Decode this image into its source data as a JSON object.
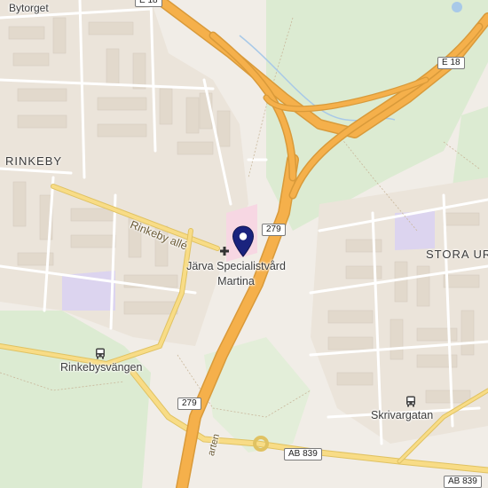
{
  "places": {
    "bytorget": "Bytorget",
    "rinkeby": "RINKEBY",
    "stora_ur": "STORA UR",
    "rinkebysvangen": "Rinkebysvängen",
    "skrivargatan": "Skrivargatan",
    "rinkeby_alle": "Rinkeby allé",
    "farten": "arten"
  },
  "poi": {
    "name_line1": "Järva Specialistvård",
    "name_line2": "Martina",
    "pin_icon": "map-pin-icon",
    "medical_icon": "medical-cross-icon"
  },
  "road_shields": {
    "e18_top": "E 18",
    "e18_right": "E 18",
    "r279_upper": "279",
    "r279_lower": "279",
    "ab839_left": "AB 839",
    "ab839_right": "AB 839"
  },
  "colors": {
    "background": "#f1ede7",
    "park": "#dcebd2",
    "highway": "#f5b04b",
    "highway_casing": "#d99a3a",
    "major_road": "#f6d67a",
    "pin": "#1a237e",
    "building_area": "#e9e2d8",
    "hospital_area": "#f7d7e3",
    "school_area": "#dcd4ef"
  }
}
